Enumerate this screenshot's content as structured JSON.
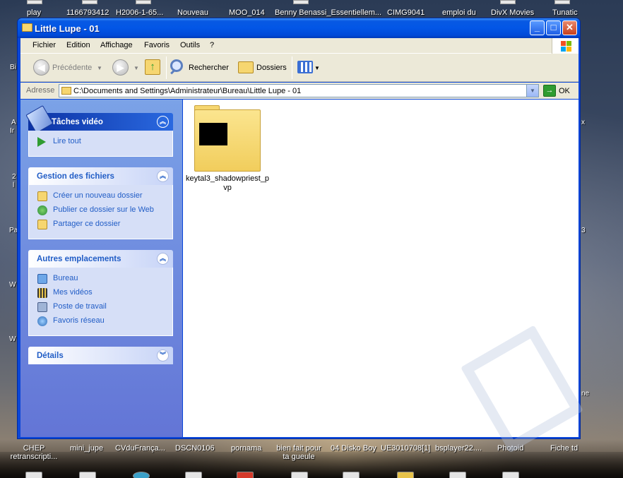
{
  "desktop": {
    "top_labels": [
      "play",
      "1166793412",
      "H2006-1-65...",
      "Nouveau",
      "MOO_014",
      "Benny Benassi_Essentiellem...",
      "CIMG9041",
      "emploi du",
      "DivX Movies",
      "Tunatic"
    ],
    "bottom_labels": [
      "CHEP retranscripti...",
      "mini_jupe",
      "CVduFrança...",
      "DSCN0106",
      "pornama",
      "bien fait pour ta gueule",
      "04 Disko Boy",
      "UE3010708[1]",
      "bsplayer22....",
      "Photoid",
      "Fiche td"
    ],
    "left_fragments": [
      "Bi",
      "A",
      "Ir",
      "2",
      "l",
      "Pa",
      "W",
      "W"
    ],
    "right_fragments": [
      "x",
      "3",
      "ne"
    ]
  },
  "window": {
    "title": "Little Lupe - 01",
    "buttons": {
      "minimize": "_",
      "maximize": "□",
      "close": "✕"
    },
    "menu": [
      "Fichier",
      "Edition",
      "Affichage",
      "Favoris",
      "Outils",
      "?"
    ],
    "toolbar": {
      "back_label": "Précédente",
      "search_label": "Rechercher",
      "folders_label": "Dossiers"
    },
    "address": {
      "label": "Adresse",
      "value": "C:\\Documents and Settings\\Administrateur\\Bureau\\Little Lupe - 01",
      "go_label": "OK"
    }
  },
  "left_pane": {
    "video_tasks": {
      "title": "Tâches vidéo",
      "items": [
        "Lire tout"
      ]
    },
    "file_tasks": {
      "title": "Gestion des fichiers",
      "items": [
        "Créer un nouveau dossier",
        "Publier ce dossier sur le Web",
        "Partager ce dossier"
      ]
    },
    "other_places": {
      "title": "Autres emplacements",
      "items": [
        "Bureau",
        "Mes vidéos",
        "Poste de travail",
        "Favoris réseau"
      ]
    },
    "details": {
      "title": "Détails"
    }
  },
  "content": {
    "items": [
      {
        "name": "keytal3_shadowpriest_p\nvp",
        "type": "folder"
      }
    ]
  },
  "colors": {
    "xp_title_blue": "#0256e6",
    "task_pane_blue": "#7ba2e7",
    "link_blue": "#215dc6",
    "folder_yellow": "#f6d670"
  }
}
